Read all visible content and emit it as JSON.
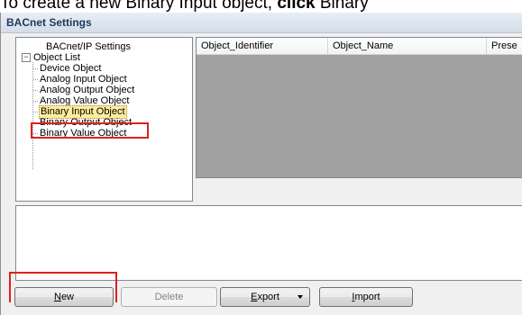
{
  "caption": {
    "prefix": "To create a new Binary Input object, ",
    "action": "click",
    "suffix": " Binary"
  },
  "window": {
    "title": "BACnet Settings"
  },
  "tree": {
    "root_item": "BACnet/IP Settings",
    "expander_symbol": "−",
    "object_list": "Object List",
    "children": [
      "Device Object",
      "Analog Input Object",
      "Analog Output Object",
      "Analog Value Object",
      "Binary Input Object",
      "Binary Output Object",
      "Binary Value Object"
    ],
    "selected_item": "Binary Input Object"
  },
  "grid": {
    "columns": [
      "Object_Identifier",
      "Object_Name",
      "Prese"
    ]
  },
  "buttons": {
    "new": "New",
    "new_mnemonic": "N",
    "new_rest": "ew",
    "delete": "Delete",
    "delete_mnemonic": "D",
    "delete_rest": "elete",
    "export_mnemonic": "E",
    "export_rest": "xport",
    "import_mnemonic": "I",
    "import_rest": "mport"
  },
  "colors": {
    "highlight": "#e02020",
    "selection_background": "#ffec9a",
    "grid_background": "#a0a0a0"
  }
}
